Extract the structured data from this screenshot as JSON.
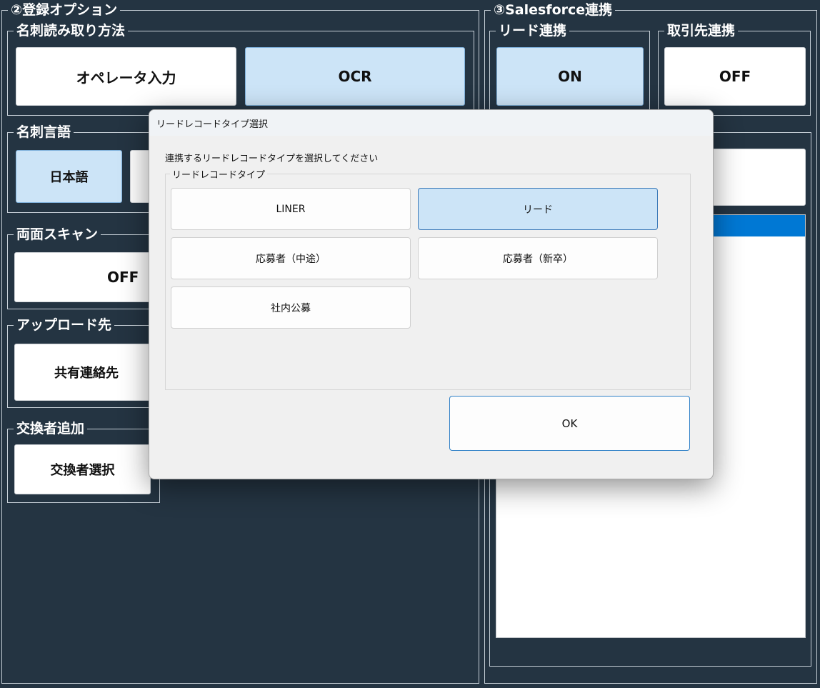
{
  "colors": {
    "background": "#243442",
    "selected": "#cce4f7",
    "list_selection": "#0078d4"
  },
  "registration": {
    "title": "②登録オプション",
    "card_read": {
      "title": "名刺読み取り方法",
      "operator_label": "オペレータ入力",
      "ocr_label": "OCR",
      "selected": "OCR"
    },
    "card_lang": {
      "title": "名刺言語",
      "japanese_label": "日本語",
      "selected": "日本語"
    },
    "duplex": {
      "title": "両面スキャン",
      "value_label": "OFF"
    },
    "upload": {
      "title": "アップロード先",
      "value_label": "共有連絡先"
    },
    "exchanger": {
      "title": "交換者追加",
      "value_label": "交換者選択"
    }
  },
  "salesforce": {
    "title": "③Salesforce連携",
    "lead": {
      "title": "リード連携",
      "value_label": "ON",
      "selected": true
    },
    "account": {
      "title": "取引先連携",
      "value_label": "OFF",
      "selected": false
    }
  },
  "dialog": {
    "title": "リードレコードタイプ選択",
    "message": "連携するリードレコードタイプを選択してください",
    "group_title": "リードレコードタイプ",
    "options": [
      "LINER",
      "リード",
      "応募者（中途）",
      "応募者（新卒）",
      "社内公募"
    ],
    "selected": "リード",
    "ok_label": "OK"
  }
}
